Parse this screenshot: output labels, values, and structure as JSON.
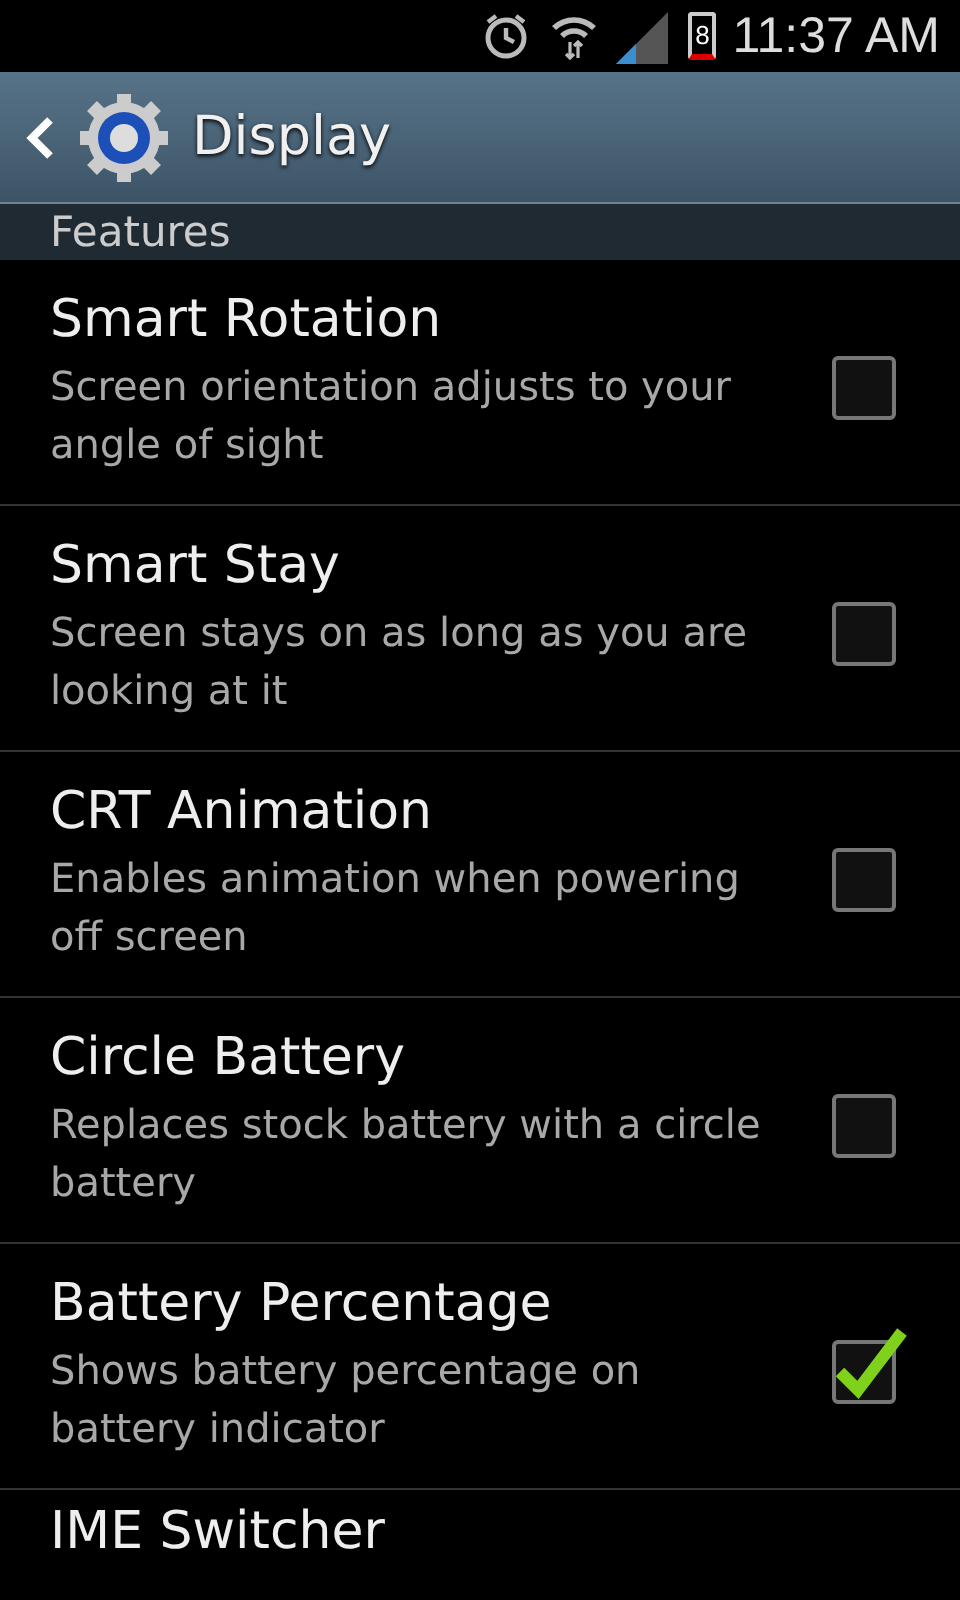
{
  "status_bar": {
    "battery_text": "8",
    "time": "11:37 AM"
  },
  "action_bar": {
    "title": "Display"
  },
  "section": {
    "title": "Features"
  },
  "items": [
    {
      "title": "Smart Rotation",
      "summary": "Screen orientation adjusts to your angle of sight",
      "checked": false
    },
    {
      "title": "Smart Stay",
      "summary": "Screen stays on as long as you are looking at it",
      "checked": false
    },
    {
      "title": "CRT Animation",
      "summary": "Enables animation when powering off screen",
      "checked": false
    },
    {
      "title": "Circle Battery",
      "summary": "Replaces stock battery with a circle battery",
      "checked": false
    },
    {
      "title": "Battery Percentage",
      "summary": "Shows battery percentage on battery indicator",
      "checked": true
    },
    {
      "title": "IME Switcher"
    }
  ]
}
